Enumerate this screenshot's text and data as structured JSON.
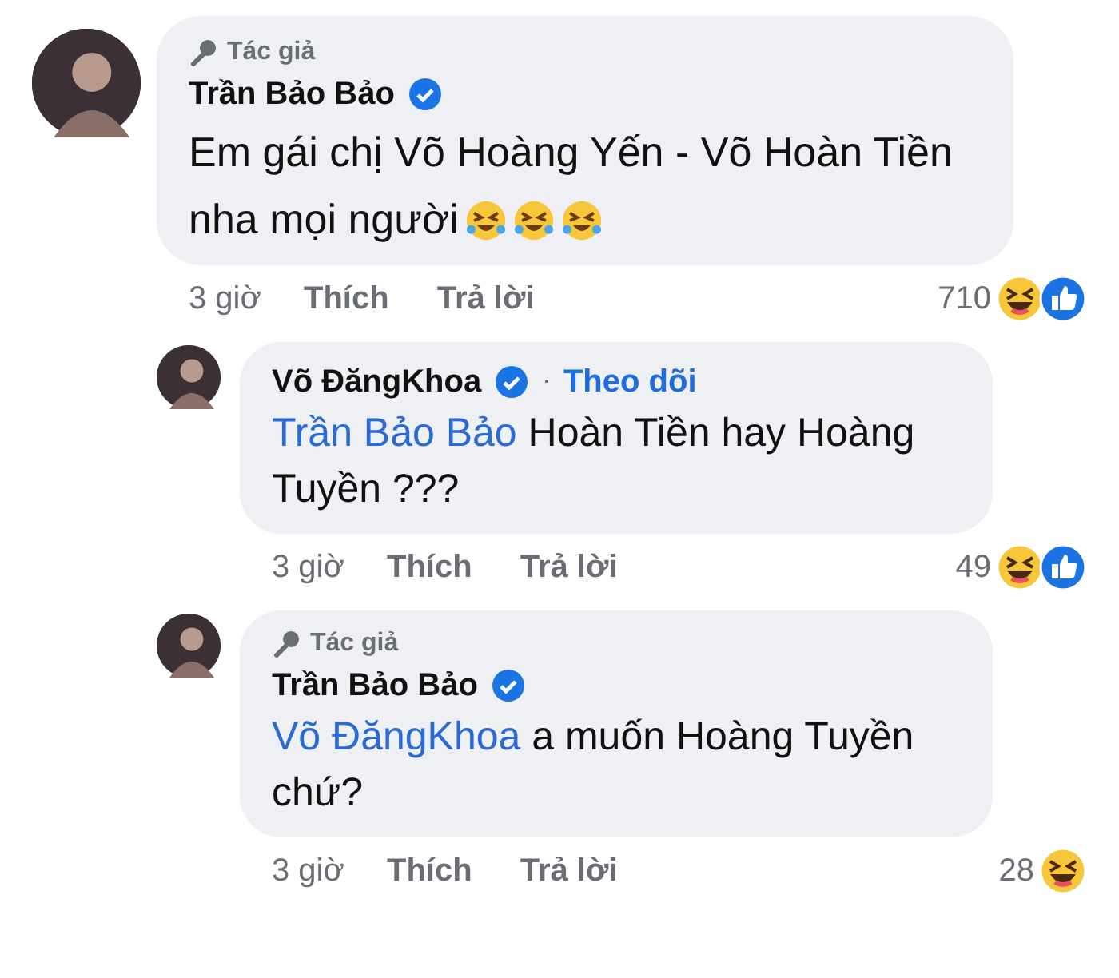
{
  "comments": [
    {
      "author_badge": "Tác giả",
      "name": "Trần Bảo Bảo",
      "verified": true,
      "body": [
        {
          "kind": "plain",
          "text": "Em gái chị Võ Hoàng Yến - Võ Hoàn Tiền nha mọi người"
        }
      ],
      "emojis": [
        {
          "kind": "rofl"
        },
        {
          "kind": "rofl"
        },
        {
          "kind": "rofl"
        }
      ],
      "time": "3 giờ",
      "like_label": "Thích",
      "reply_label": "Trả lời",
      "reaction_count": "710",
      "reactions": [
        {
          "kind": "haha"
        },
        {
          "kind": "like"
        }
      ],
      "indent": false
    },
    {
      "name": "Võ ĐăngKhoa",
      "verified": true,
      "separator": "·",
      "follow": "Theo dõi",
      "body": [
        {
          "kind": "mention",
          "text": "Trần Bảo Bảo"
        },
        {
          "kind": "plain",
          "text": " Hoàn Tiền hay Hoàng Tuyền ???"
        }
      ],
      "time": "3 giờ",
      "like_label": "Thích",
      "reply_label": "Trả lời",
      "reaction_count": "49",
      "reactions": [
        {
          "kind": "haha"
        },
        {
          "kind": "like"
        }
      ],
      "indent": true
    },
    {
      "author_badge": "Tác giả",
      "name": "Trần Bảo Bảo",
      "verified": true,
      "body": [
        {
          "kind": "mention",
          "text": "Võ ĐăngKhoa"
        },
        {
          "kind": "plain",
          "text": " a muốn Hoàng Tuyền chứ?"
        }
      ],
      "time": "3 giờ",
      "like_label": "Thích",
      "reply_label": "Trả lời",
      "reaction_count": "28",
      "reactions": [
        {
          "kind": "haha"
        }
      ],
      "indent": true
    }
  ]
}
